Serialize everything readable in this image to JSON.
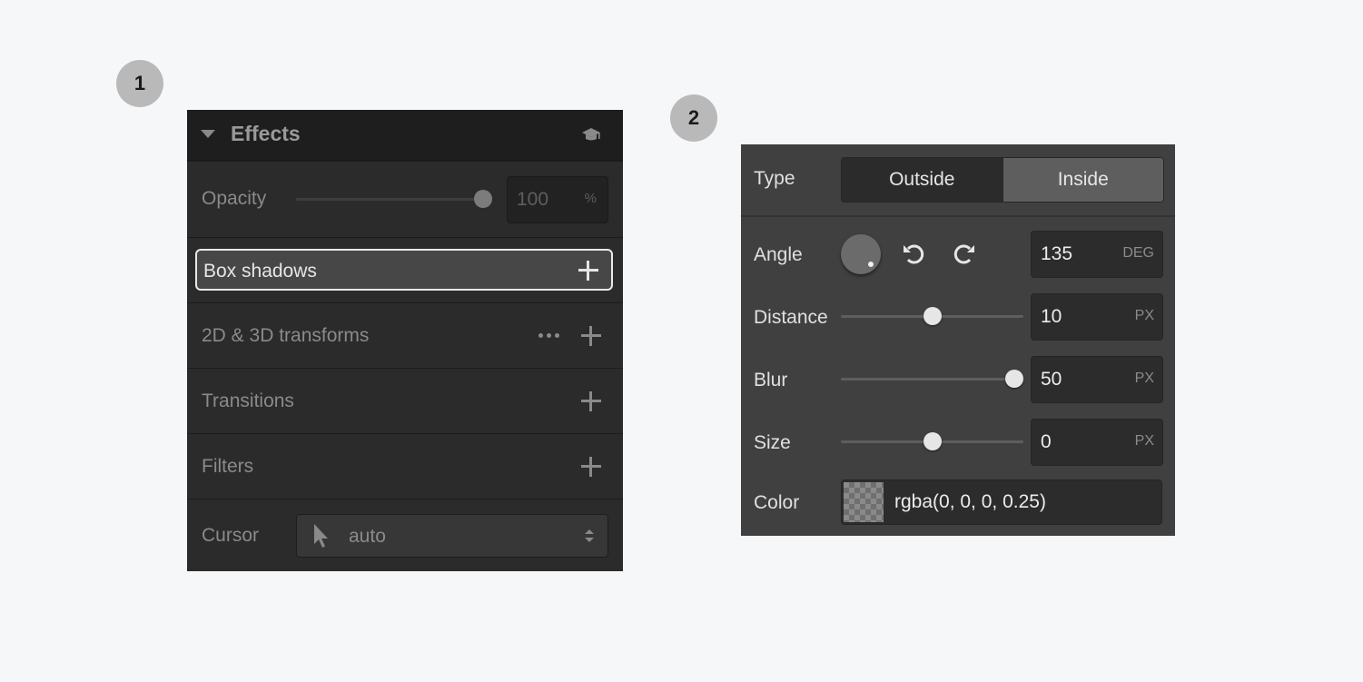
{
  "badges": {
    "one": "1",
    "two": "2"
  },
  "effects_panel": {
    "title": "Effects",
    "icons": {
      "collapse": "caret-down-icon",
      "help": "graduation-cap-icon"
    },
    "opacity": {
      "label": "Opacity",
      "value": "100",
      "unit": "%",
      "level": 1.0
    },
    "sections": {
      "box_shadows": "Box shadows",
      "transforms": "2D & 3D transforms",
      "transitions": "Transitions",
      "filters": "Filters"
    },
    "cursor": {
      "label": "Cursor",
      "value": "auto",
      "icon": "pointer-arrow-icon"
    }
  },
  "shadow_panel": {
    "type": {
      "label": "Type",
      "options": [
        "Outside",
        "Inside"
      ],
      "selected": "Inside"
    },
    "angle": {
      "label": "Angle",
      "value": "135",
      "unit": "DEG"
    },
    "distance": {
      "label": "Distance",
      "value": "10",
      "unit": "PX",
      "level": 0.5
    },
    "blur": {
      "label": "Blur",
      "value": "50",
      "unit": "PX",
      "level": 0.95
    },
    "size": {
      "label": "Size",
      "value": "0",
      "unit": "PX",
      "level": 0.5
    },
    "color": {
      "label": "Color",
      "value": "rgba(0, 0, 0, 0.25)"
    }
  },
  "colors": {
    "background": "#f6f7f9",
    "panel_dark": "#2b2b2b",
    "panel_mid": "#404040",
    "highlight_border": "#e8e8e8"
  }
}
